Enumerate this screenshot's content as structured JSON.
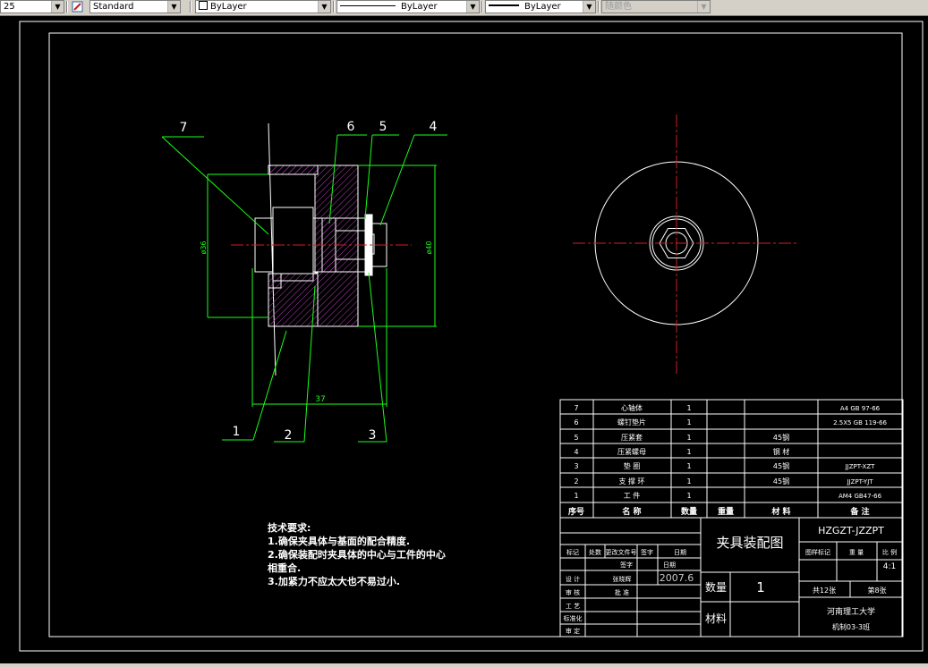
{
  "toolbar": {
    "first_value": "25",
    "text_style": "Standard",
    "layer": "ByLayer",
    "linetype": "ByLayer",
    "lineweight": "ByLayer",
    "plot_style": "随颜色"
  },
  "drawing": {
    "balloons": [
      "7",
      "6",
      "5",
      "4",
      "1",
      "2",
      "3"
    ],
    "dim_dia36": "ø36",
    "dim_dia40": "ø40",
    "dim_length": "37",
    "notes": {
      "title": "技术要求:",
      "lines": [
        "1.确保夹具体与基面的配合精度.",
        "2.确保装配时夹具体的中心与工件的中心",
        "相重合.",
        "3.加紧力不应太大也不易过小."
      ]
    }
  },
  "bom": {
    "rows": [
      {
        "no": "7",
        "name": "心轴体",
        "qty": "1",
        "mat": "",
        "remark": "A4 GB 97-66"
      },
      {
        "no": "6",
        "name": "螺钉垫片",
        "qty": "1",
        "mat": "",
        "remark": "2.5X5 GB 119-66"
      },
      {
        "no": "5",
        "name": "压紧套",
        "qty": "1",
        "mat": "45钢",
        "remark": ""
      },
      {
        "no": "4",
        "name": "压紧螺母",
        "qty": "1",
        "mat": "钢 材",
        "remark": ""
      },
      {
        "no": "3",
        "name": "垫 圈",
        "qty": "1",
        "mat": "45钢",
        "remark": "JJZPT-XZT"
      },
      {
        "no": "2",
        "name": "支 撑 环",
        "qty": "1",
        "mat": "45钢",
        "remark": "JJZPT-YJT"
      },
      {
        "no": "1",
        "name": "工 件",
        "qty": "1",
        "mat": "",
        "remark": "AM4 GB47-66"
      }
    ],
    "header": {
      "no": "序号",
      "name": "名 称",
      "qty": "数量",
      "weight": "重量",
      "mat": "材 料",
      "remark": "备 注"
    }
  },
  "title_block": {
    "drawing_title": "夹具装配图",
    "drawing_code": "HZGZT-JZZPT",
    "rev_headers": [
      "标记",
      "处数",
      "更改文件号",
      "签字",
      "日期"
    ],
    "sign_label": "签字",
    "date_label": "日期",
    "date": "2007.6",
    "role_design": "设 计",
    "role_check": "审 核",
    "role_process": "工 艺",
    "role_std": "标准化",
    "role_approve": "审 定",
    "designer": "张晓辉",
    "standard": "批 准",
    "qty_label": "数量",
    "qty_value": "1",
    "material_label": "材料",
    "stage_label": "图样标记",
    "weight_label": "重 量",
    "scale_label": "比 例",
    "scale_value": "4:1",
    "sheets_total": "共12张",
    "sheet_no": "第8张",
    "school": "河南理工大学",
    "class": "机制03-3班"
  }
}
